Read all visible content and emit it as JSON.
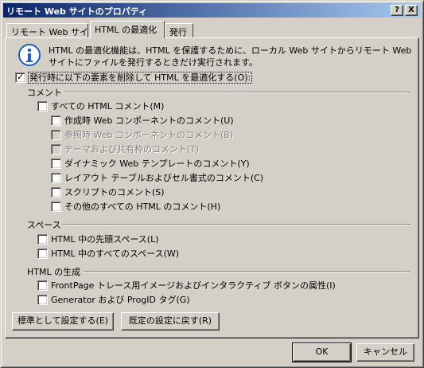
{
  "window": {
    "title": "リモート Web サイトのプロパティ",
    "help_glyph": "?",
    "close_glyph": "X"
  },
  "tabs": [
    "リモート Web サイト",
    "HTML の最適化",
    "発行"
  ],
  "info": {
    "description": "HTML の最適化機能は、HTML を保護するために、ローカル Web サイトからリモート Web サイトにファイルを発行するときだけ実行されます。"
  },
  "main_option": {
    "label": "発行時に以下の要素を削除して HTML を最適化する(O):",
    "checked": true
  },
  "sections": {
    "comments": {
      "title": "コメント",
      "all": "すべての HTML コメント(M)",
      "items": [
        "作成時 Web コンポーネントのコメント(U)",
        "参照時 Web コンポーネントのコメント(B)",
        "テーマおよび共有枠のコメント(T)",
        "ダイナミック Web テンプレートのコメント(Y)",
        "レイアウト テーブルおよびセル書式のコメント(C)",
        "スクリプトのコメント(S)",
        "その他のすべての HTML のコメント(H)"
      ]
    },
    "spaces": {
      "title": "スペース",
      "items": [
        "HTML 中の先頭スペース(L)",
        "HTML 中のすべてのスペース(W)"
      ]
    },
    "generation": {
      "title": "HTML の生成",
      "items": [
        "FrontPage トレース用イメージおよびインタラクティブ ボタンの属性(I)",
        "Generator および ProgID タグ(G)"
      ]
    }
  },
  "buttons": {
    "set_default": "標準として設定する(E)",
    "restore_default": "既定の設定に戻す(R)",
    "ok": "OK",
    "cancel": "キャンセル"
  },
  "icons": {
    "info": "info-icon",
    "check": "check-icon"
  },
  "colors": {
    "title_start": "#0a246a",
    "title_end": "#a6caf0",
    "face": "#d4d0c8",
    "icon_blue": "#1f5fbf"
  }
}
